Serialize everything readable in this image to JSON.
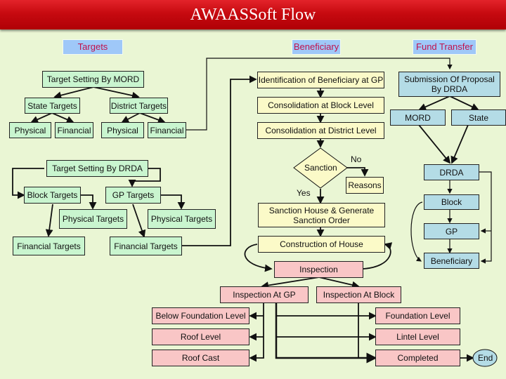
{
  "title": "AWAASSoft Flow",
  "headers": {
    "targets": "Targets",
    "beneficiary": "Beneficiary",
    "fund_transfer": "Fund Transfer"
  },
  "targets": {
    "mord": "Target Setting By MORD",
    "state_targets": "State Targets",
    "district_targets": "District Targets",
    "state_physical": "Physical",
    "state_financial": "Financial",
    "district_physical": "Physical",
    "district_financial": "Financial",
    "drda": "Target Setting By DRDA",
    "block_targets": "Block Targets",
    "gp_targets": "GP Targets",
    "block_physical": "Physical Targets",
    "gp_physical": "Physical Targets",
    "block_financial": "Financial Targets",
    "gp_financial": "Financial Targets"
  },
  "beneficiary": {
    "identification": "Identification of Beneficiary at GP",
    "block_consolidation": "Consolidation at Block Level",
    "district_consolidation": "Consolidation at District Level",
    "sanction": "Sanction",
    "no": "No",
    "yes": "Yes",
    "reasons": "Reasons",
    "sanction_house_1": "Sanction House & Generate",
    "sanction_house_2": "Sanction Order",
    "construction": "Construction of House",
    "inspection": "Inspection",
    "inspection_gp": "Inspection At GP",
    "inspection_block": "Inspection At Block",
    "below_foundation": "Below Foundation Level",
    "roof_level": "Roof Level",
    "roof_cast": "Roof Cast",
    "foundation": "Foundation Level",
    "lintel": "Lintel Level",
    "completed": "Completed",
    "end": "End"
  },
  "fund": {
    "submission_1": "Submission Of Proposal",
    "submission_2": "By DRDA",
    "mord": "MORD",
    "state": "State",
    "drda": "DRDA",
    "block": "Block",
    "gp": "GP",
    "beneficiary": "Beneficiary"
  },
  "colors": {
    "background": "#eaf6d4",
    "title_bar": "#c70a10",
    "header_fill": "#9fc8f8",
    "header_text": "#c0124c",
    "targets_fill": "#c9f5cf",
    "beneficiary_fill": "#fbfac8",
    "fund_fill": "#b4dce6",
    "inspection_fill": "#f9c6c6"
  }
}
